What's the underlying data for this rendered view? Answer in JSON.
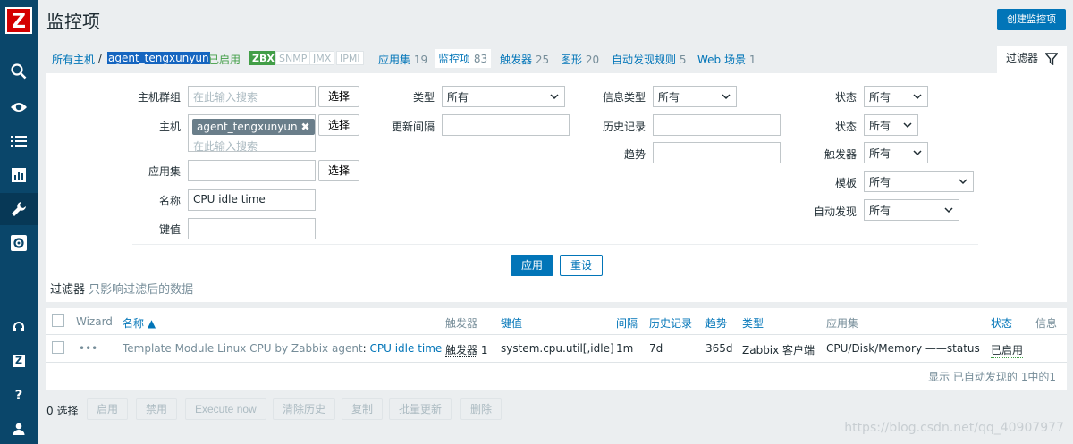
{
  "app": {
    "logo": "Z",
    "title": "监控项",
    "create_button": "创建监控项"
  },
  "sidebar": {
    "icons": [
      "search-icon",
      "eye-icon",
      "list-icon",
      "chart-icon",
      "wrench-icon",
      "gear-icon",
      "support-icon",
      "share-icon",
      "help-icon",
      "user-icon"
    ],
    "share_glyph": "Z",
    "help_glyph": "?"
  },
  "nav": {
    "all_hosts": "所有主机",
    "separator": "/",
    "host": "agent_tengxunyun",
    "status": "已启用",
    "badges": [
      "ZBX",
      "SNMP",
      "JMX",
      "IPMI"
    ],
    "applications": {
      "label": "应用集",
      "count": "19"
    },
    "items": {
      "label": "监控项",
      "count": "83"
    },
    "triggers": {
      "label": "触发器",
      "count": "25"
    },
    "graphs": {
      "label": "图形",
      "count": "20"
    },
    "discovery": {
      "label": "自动发现规则",
      "count": "5"
    },
    "web": {
      "label": "Web 场景",
      "count": "1"
    }
  },
  "filter": {
    "tab_label": "过滤器",
    "host_groups_label": "主机群组",
    "host_groups_placeholder": "在此输入搜索",
    "select_button": "选择",
    "hosts_label": "主机",
    "host_tag": "agent_tengxunyun",
    "hosts_placeholder": "在此输入搜索",
    "applications_label": "应用集",
    "name_label": "名称",
    "name_value": "CPU idle time",
    "key_label": "键值",
    "type_label": "类型",
    "type_value": "所有",
    "interval_label": "更新间隔",
    "info_type_label": "信息类型",
    "info_type_value": "所有",
    "history_label": "历史记录",
    "trends_label": "趋势",
    "state_label": "状态",
    "state_value": "所有",
    "status_label": "状态",
    "status_value": "所有",
    "triggers_label": "触发器",
    "triggers_value": "所有",
    "template_label": "模板",
    "template_value": "所有",
    "discovery_label": "自动发现",
    "discovery_value": "所有",
    "apply_button": "应用",
    "reset_button": "重设",
    "note_title": "过滤器",
    "note_sub": "只影响过滤后的数据"
  },
  "table": {
    "headers": {
      "wizard": "Wizard",
      "name": "名称 ▲",
      "triggers": "触发器",
      "key": "键值",
      "interval": "间隔",
      "history": "历史记录",
      "trends": "趋势",
      "type": "类型",
      "applications": "应用集",
      "status": "状态",
      "info": "信息"
    },
    "rows": [
      {
        "template": "Template Module Linux CPU by Zabbix agent",
        "name": "CPU idle time",
        "triggers_label": "触发器",
        "triggers_count": "1",
        "key": "system.cpu.util[,idle]",
        "interval": "1m",
        "history": "7d",
        "trends": "365d",
        "type": "Zabbix 客户端",
        "applications": "CPU/Disk/Memory ——status",
        "status": "已启用"
      }
    ],
    "footer": "显示 已自动发现的 1中的1"
  },
  "actions": {
    "selected": "0 选择",
    "buttons": [
      "启用",
      "禁用",
      "Execute now",
      "清除历史",
      "复制",
      "批量更新",
      "删除"
    ]
  },
  "watermark": "https://blog.csdn.net/qq_40907977",
  "colors": {
    "sidebar": "#0a466a",
    "accent": "#0275b8",
    "enabled": "#429e47",
    "logo": "#d40000"
  }
}
